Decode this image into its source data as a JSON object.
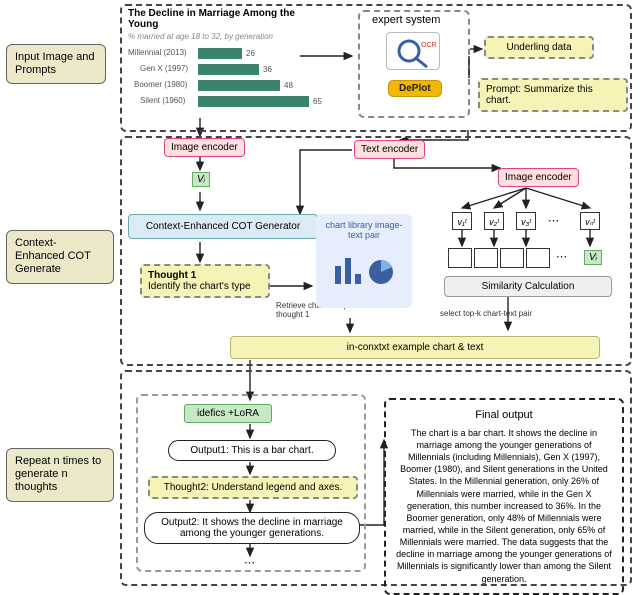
{
  "chart_data": {
    "type": "bar",
    "title": "The Decline in Marriage Among the Young",
    "subtitle": "% married at age 18 to 32, by generation",
    "categories": [
      "Millennial (2013)",
      "Gen X (1997)",
      "Boomer (1980)",
      "Silent (1960)"
    ],
    "values": [
      26,
      36,
      48,
      65
    ],
    "xlabel": "",
    "ylabel": "",
    "ylim": [
      0,
      70
    ]
  },
  "stages": {
    "s1": "Input Image and\nPrompts",
    "s2": "Context-Enhanced\nCOT Generate",
    "s3": "Repeat n times to\ngenerate n\nthoughts"
  },
  "expert": {
    "title": "expert system",
    "icon1": "ocr-icon",
    "deplot": "DePlot",
    "underling": "Underling data",
    "prompt": "Prompt: Summarize this chart."
  },
  "encoders": {
    "image": "Image encoder",
    "text": "Text encoder",
    "image2": "Image encoder"
  },
  "vi": "Vᵢ",
  "cot": "Context-Enhanced COT Generator",
  "thought1": {
    "label": "Thought 1",
    "text": "Identify the chart's type"
  },
  "retrieve_note": "Retrieve chart-text\npairs for thought 1",
  "library": "chart library\nimage-text pair",
  "sim": "Similarity Calculation",
  "vts": {
    "v1": "v₁ᵗ",
    "v2": "v₂ᵗ",
    "v3": "v₃ᵗ",
    "vn": "vₙᵗ"
  },
  "select_note": "select top-k chart-text pair",
  "incontext": "in-conxtxt example chart & text",
  "lora": "idefics   +LoRA",
  "output1": "Output1: This is a bar chart.",
  "thought2": "Thought2: Understand legend and axes.",
  "output2": "Output2: It shows the decline in marriage\namong the younger generations.",
  "dots": "⋯",
  "final": {
    "title": "Final output",
    "body": "The chart is a bar chart. It shows the decline in marriage among the younger generations of Millennials (including Millennials), Gen X (1997), Boomer (1980), and Silent generations in the United States. In the Millennial generation, only 26% of Millennials were married, while in the Gen X generation, this number increased to 36%. In the Boomer generation, only 48% of Millennials were married, while in the Silent generation, only 65% of Millennials were married. The data suggests that the decline in marriage among the younger generations of Millennials is significantly lower than among the Silent generation."
  }
}
